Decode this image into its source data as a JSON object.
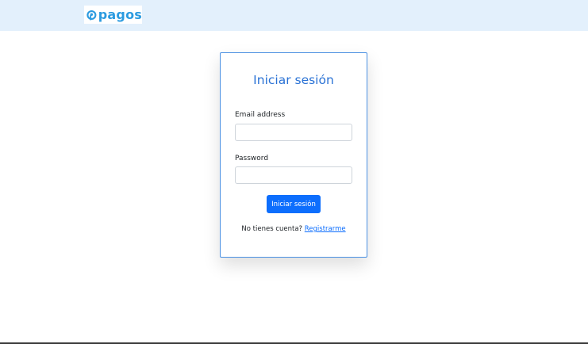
{
  "brand": {
    "name": "pagos",
    "icon": "pagos-logo-icon",
    "color": "#2c9be0"
  },
  "login": {
    "title": "Iniciar sesión",
    "email_label": "Email address",
    "email_value": "",
    "password_label": "Password",
    "password_value": "",
    "submit_label": "Iniciar sesión",
    "register_prompt": "No tienes cuenta?",
    "register_link": "Registrarme"
  },
  "colors": {
    "navbar_bg": "#e3f0fc",
    "title": "#2a72d5",
    "primary": "#0d6efd",
    "card_border": "#4a90e2"
  }
}
